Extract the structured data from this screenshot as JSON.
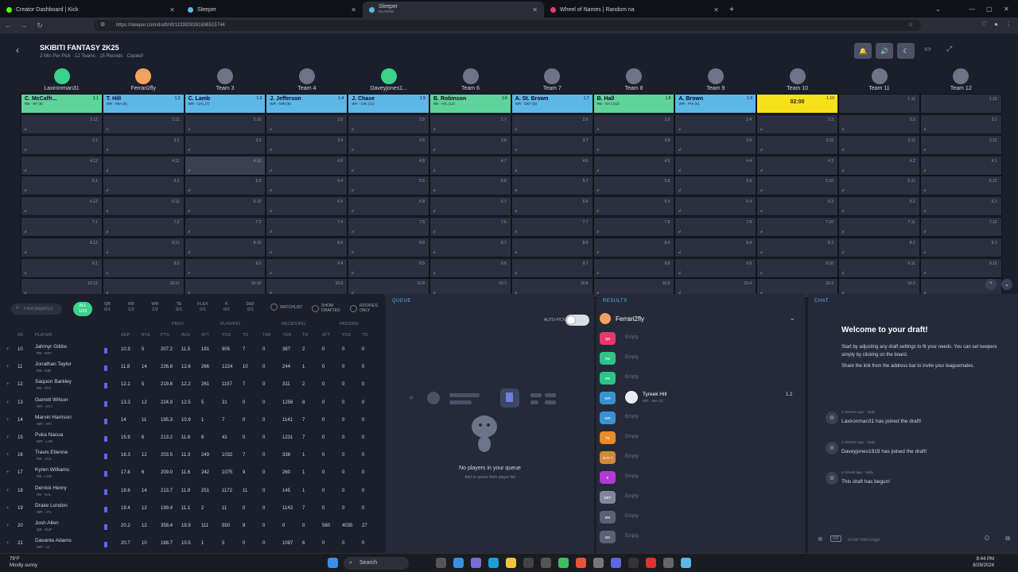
{
  "browser": {
    "tabs": [
      {
        "title": "Creator Dashboard | Kick",
        "color": "#53fc18"
      },
      {
        "title": "Sleeper",
        "color": "#5cb7e6"
      },
      {
        "title": "Sleeper",
        "subtitle": "PLAYING",
        "color": "#5cb7e6"
      },
      {
        "title": "Wheel of Names | Random na",
        "color": "#e63c6f"
      }
    ],
    "url": "https://sleeper.com/draft/nfl/1133928261636515744"
  },
  "draft": {
    "title": "SKIBITI FANTASY 2K25",
    "subtitle": "2 Min Per Pick · 12 Teams · 15 Rounds · Copied!",
    "teams": [
      "Laxironman31",
      "Ferrari2fly",
      "Team 3",
      "Team 4",
      "Daveyjones1...",
      "Team 6",
      "Team 7",
      "Team 8",
      "Team 9",
      "Team 10",
      "Team 11",
      "Team 12"
    ],
    "first_round": [
      {
        "name": "C. McCaffr...",
        "pos": "RB - SF (9)",
        "num": "1.1",
        "type": "rb"
      },
      {
        "name": "T. Hill",
        "pos": "WR - MIA (6)",
        "num": "1.2",
        "type": "wr"
      },
      {
        "name": "C. Lamb",
        "pos": "WR - DAL (7)",
        "num": "1.3",
        "type": "wr"
      },
      {
        "name": "J. Jefferson",
        "pos": "WR - MIN (6)",
        "num": "1.4",
        "type": "wr"
      },
      {
        "name": "J. Chase",
        "pos": "WR - CIN (12)",
        "num": "1.5",
        "type": "wr"
      },
      {
        "name": "B. Robinson",
        "pos": "RB - ATL (12)",
        "num": "1.6",
        "type": "rb"
      },
      {
        "name": "A. St. Brown",
        "pos": "WR - DET (5)",
        "num": "1.7",
        "type": "wr"
      },
      {
        "name": "B. Hall",
        "pos": "RB - NYJ (12)",
        "num": "1.8",
        "type": "rb"
      },
      {
        "name": "A. Brown",
        "pos": "WR - PHI (5)",
        "num": "1.9",
        "type": "wr"
      },
      {
        "name": "02:00",
        "pos": "",
        "num": "1.10",
        "type": "clock"
      },
      {
        "name": "",
        "pos": "",
        "num": "1.11",
        "type": "empty"
      },
      {
        "name": "",
        "pos": "",
        "num": "1.12",
        "type": "empty"
      }
    ],
    "rounds": [
      [
        "2.12",
        "2.11",
        "2.10",
        "2.9",
        "2.8",
        "2.7",
        "2.6",
        "2.5",
        "2.4",
        "2.3",
        "2.2",
        "2.1"
      ],
      [
        "3.1",
        "3.2",
        "3.3",
        "3.4",
        "3.5",
        "3.6",
        "3.7",
        "3.8",
        "3.9",
        "3.10",
        "3.11",
        "3.12"
      ],
      [
        "4.12",
        "4.11",
        "4.10",
        "4.9",
        "4.8",
        "4.7",
        "4.6",
        "4.5",
        "4.4",
        "4.3",
        "4.2",
        "4.1"
      ],
      [
        "5.1",
        "5.2",
        "5.3",
        "5.4",
        "5.5",
        "5.6",
        "5.7",
        "5.8",
        "5.9",
        "5.10",
        "5.11",
        "5.12"
      ],
      [
        "6.12",
        "6.11",
        "6.10",
        "6.9",
        "6.8",
        "6.7",
        "6.6",
        "6.5",
        "6.4",
        "6.3",
        "6.2",
        "6.1"
      ],
      [
        "7.1",
        "7.2",
        "7.3",
        "7.4",
        "7.5",
        "7.6",
        "7.7",
        "7.8",
        "7.9",
        "7.10",
        "7.11",
        "7.12"
      ],
      [
        "8.12",
        "8.11",
        "8.10",
        "8.9",
        "8.8",
        "8.7",
        "8.6",
        "8.5",
        "8.4",
        "8.3",
        "8.2",
        "8.1"
      ],
      [
        "9.1",
        "9.2",
        "9.3",
        "9.4",
        "9.5",
        "9.6",
        "9.7",
        "9.8",
        "9.9",
        "9.10",
        "9.11",
        "9.12"
      ],
      [
        "10.12",
        "10.11",
        "10.10",
        "10.9",
        "10.8",
        "10.7",
        "10.6",
        "10.5",
        "10.4",
        "10.3",
        "10.2",
        "10.1"
      ]
    ]
  },
  "players_panel": {
    "search_placeholder": "Find player(s)",
    "positions": [
      {
        "label": "ALL",
        "count": "1/15"
      },
      {
        "label": "QB",
        "count": "0/1"
      },
      {
        "label": "RB",
        "count": "1/2"
      },
      {
        "label": "WR",
        "count": "1/2"
      },
      {
        "label": "TE",
        "count": "0/1"
      },
      {
        "label": "FLEX",
        "count": "0/1"
      },
      {
        "label": "K",
        "count": "0/1"
      },
      {
        "label": "DEF",
        "count": "0/1"
      }
    ],
    "watchlist": "WATCHLIST",
    "show_drafted": "SHOW DRAFTED",
    "rookies_only": "ROOKIES ONLY",
    "group_headers": [
      "PROJ",
      "RUSHING",
      "RECEIVING",
      "PASSING"
    ],
    "headers": [
      "RK",
      "PLAYER",
      "ADP",
      "BYE",
      "PTS",
      "AVG",
      "ATT",
      "YDS",
      "TD",
      "TAR",
      "YDS",
      "TD",
      "ATT",
      "YDS",
      "TD"
    ],
    "rows": [
      {
        "rk": "10",
        "name": "Jahmyr Gibbs",
        "pos": "RB - DET",
        "adp": "10.3",
        "bye": "5",
        "pts": "207.2",
        "avg": "11.5",
        "ratt": "191",
        "ryds": "905",
        "rtd": "7",
        "tar": "0",
        "recyds": "387",
        "rectd": "2",
        "patt": "0",
        "pyds": "0",
        "ptd": "0"
      },
      {
        "rk": "11",
        "name": "Jonathan Taylor",
        "pos": "RB - IND",
        "adp": "11.8",
        "bye": "14",
        "pts": "226.8",
        "avg": "12.6",
        "ratt": "266",
        "ryds": "1224",
        "rtd": "10",
        "tar": "0",
        "recyds": "244",
        "rectd": "1",
        "patt": "0",
        "pyds": "0",
        "ptd": "0"
      },
      {
        "rk": "12",
        "name": "Saquon Barkley",
        "pos": "RB - PHI",
        "adp": "12.1",
        "bye": "5",
        "pts": "219.8",
        "avg": "12.2",
        "ratt": "261",
        "ryds": "1157",
        "rtd": "7",
        "tar": "0",
        "recyds": "311",
        "rectd": "2",
        "patt": "0",
        "pyds": "0",
        "ptd": "0"
      },
      {
        "rk": "13",
        "name": "Garrett Wilson",
        "pos": "WR - NYJ",
        "adp": "13.3",
        "bye": "12",
        "pts": "224.9",
        "avg": "12.5",
        "ratt": "5",
        "ryds": "31",
        "rtd": "0",
        "tar": "0",
        "recyds": "1256",
        "rectd": "8",
        "patt": "0",
        "pyds": "0",
        "ptd": "0"
      },
      {
        "rk": "14",
        "name": "Marvin Harrison",
        "pos": "WR - ARI",
        "adp": "14",
        "bye": "11",
        "pts": "195.3",
        "avg": "10.9",
        "ratt": "1",
        "ryds": "7",
        "rtd": "0",
        "tar": "0",
        "recyds": "1141",
        "rectd": "7",
        "patt": "0",
        "pyds": "0",
        "ptd": "0"
      },
      {
        "rk": "15",
        "name": "Puka Nacua",
        "pos": "WR - LAR",
        "adp": "15.9",
        "bye": "6",
        "pts": "213.2",
        "avg": "11.8",
        "ratt": "8",
        "ryds": "41",
        "rtd": "0",
        "tar": "0",
        "recyds": "1231",
        "rectd": "7",
        "patt": "0",
        "pyds": "0",
        "ptd": "0"
      },
      {
        "rk": "16",
        "name": "Travis Etienne",
        "pos": "RB - JAX",
        "adp": "16.3",
        "bye": "12",
        "pts": "203.5",
        "avg": "11.3",
        "ratt": "249",
        "ryds": "1032",
        "rtd": "7",
        "tar": "0",
        "recyds": "338",
        "rectd": "1",
        "patt": "0",
        "pyds": "0",
        "ptd": "0"
      },
      {
        "rk": "17",
        "name": "Kyren Williams",
        "pos": "RB - LAR",
        "adp": "17.8",
        "bye": "6",
        "pts": "209.0",
        "avg": "11.6",
        "ratt": "242",
        "ryds": "1075",
        "rtd": "9",
        "tar": "0",
        "recyds": "260",
        "rectd": "1",
        "patt": "0",
        "pyds": "0",
        "ptd": "0"
      },
      {
        "rk": "18",
        "name": "Derrick Henry",
        "pos": "RB - BAL",
        "adp": "18.6",
        "bye": "14",
        "pts": "213.7",
        "avg": "11.9",
        "ratt": "251",
        "ryds": "1172",
        "rtd": "11",
        "tar": "0",
        "recyds": "145",
        "rectd": "1",
        "patt": "0",
        "pyds": "0",
        "ptd": "0"
      },
      {
        "rk": "19",
        "name": "Drake London",
        "pos": "WR - ATL",
        "adp": "19.4",
        "bye": "12",
        "pts": "199.4",
        "avg": "11.1",
        "ratt": "2",
        "ryds": "11",
        "rtd": "0",
        "tar": "0",
        "recyds": "1143",
        "rectd": "7",
        "patt": "0",
        "pyds": "0",
        "ptd": "0"
      },
      {
        "rk": "20",
        "name": "Josh Allen",
        "pos": "QB - BUF",
        "adp": "20.2",
        "bye": "12",
        "pts": "358.4",
        "avg": "19.9",
        "ratt": "111",
        "ryds": "550",
        "rtd": "9",
        "tar": "0",
        "recyds": "0",
        "rectd": "0",
        "patt": "560",
        "pyds": "4035",
        "ptd": "27"
      },
      {
        "rk": "21",
        "name": "Davante Adams",
        "pos": "WR - LV",
        "adp": "20.7",
        "bye": "10",
        "pts": "188.7",
        "avg": "10.5",
        "ratt": "1",
        "ryds": "5",
        "rtd": "0",
        "tar": "0",
        "recyds": "1087",
        "rectd": "6",
        "patt": "0",
        "pyds": "0",
        "ptd": "0"
      }
    ]
  },
  "queue": {
    "title": "QUEUE",
    "autopick": "AUTO-PICK",
    "empty_title": "No players in your queue",
    "empty_sub": "Add to queue from player list"
  },
  "results": {
    "title": "RESULTS",
    "team": "Ferrari2fly",
    "slots": [
      {
        "pos": "QB",
        "color": "#e6396b",
        "label": "Empty"
      },
      {
        "pos": "RB",
        "color": "#2fc38a",
        "label": "Empty"
      },
      {
        "pos": "RB",
        "color": "#2fc38a",
        "label": "Empty"
      },
      {
        "pos": "WR",
        "color": "#3a92d3",
        "label": "Tyreek Hill",
        "sub": "WR - MIA (6)",
        "pick": "1.2"
      },
      {
        "pos": "WR",
        "color": "#3a92d3",
        "label": "Empty"
      },
      {
        "pos": "TE",
        "color": "#e98a2c",
        "label": "Empty"
      },
      {
        "pos": "W R T",
        "color": "#d18a3a",
        "label": "Empty"
      },
      {
        "pos": "K",
        "color": "#b13ad1",
        "label": "Empty"
      },
      {
        "pos": "DEF",
        "color": "#7f879b",
        "label": "Empty"
      },
      {
        "pos": "BN",
        "color": "#5a6277",
        "label": "Empty"
      },
      {
        "pos": "BN",
        "color": "#5a6277",
        "label": "Empty"
      }
    ]
  },
  "chat": {
    "title": "CHAT",
    "welcome": "Welcome to your draft!",
    "p1": "Start by adjusting any draft settings to fit your needs. You can set keepers simply by clicking on the board.",
    "p2": "Share the link from the address bar to invite your leaguemates.",
    "messages": [
      {
        "time": "2 minutes ago · reply",
        "text": "Laxironman31 has joined the draft!"
      },
      {
        "time": "2 minutes ago · reply",
        "text": "Daveyjones1919 has joined the draft!"
      },
      {
        "time": "a minute ago · reply",
        "text": "This draft has begun!"
      }
    ],
    "input_placeholder": "Enter Message"
  },
  "taskbar": {
    "temp": "79°F",
    "weather": "Mostly sunny",
    "search": "Search",
    "time": "8:44 PM",
    "date": "8/28/2024"
  }
}
